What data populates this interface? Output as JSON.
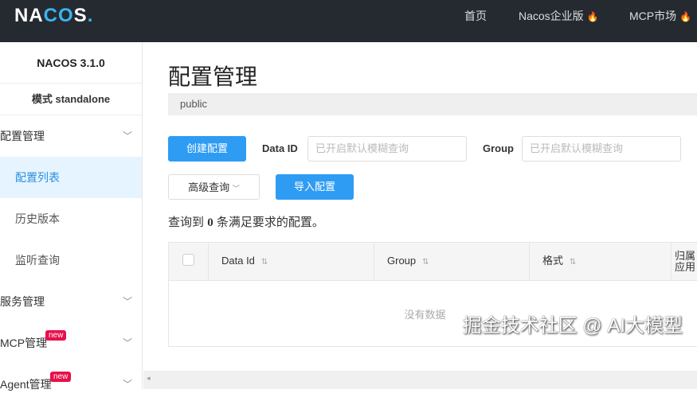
{
  "header": {
    "logo": "NACOS.",
    "nav": [
      {
        "label": "首页"
      },
      {
        "label": "Nacos企业版",
        "hot": true
      },
      {
        "label": "MCP市场",
        "hot": true
      }
    ]
  },
  "sidebar": {
    "version": "NACOS 3.1.0",
    "mode": "模式 standalone",
    "items": [
      {
        "label": "配置管理",
        "expand": true
      },
      {
        "label": "配置列表"
      },
      {
        "label": "历史版本"
      },
      {
        "label": "监听查询"
      },
      {
        "label": "服务管理"
      },
      {
        "label": "MCP管理",
        "badge": "new"
      },
      {
        "label": "Agent管理",
        "badge": "new"
      }
    ]
  },
  "main": {
    "title": "配置管理",
    "namespace": "public",
    "create_btn": "创建配置",
    "data_id_label": "Data ID",
    "data_id_placeholder": "已开启默认模糊查询",
    "group_label": "Group",
    "group_placeholder": "已开启默认模糊查询",
    "advanced_btn": "高级查询",
    "import_btn": "导入配置",
    "count_prefix": "查询到",
    "count": "0",
    "count_suffix": "条满足要求的配置。",
    "columns": [
      "Data Id",
      "Group",
      "格式",
      "归属应用"
    ],
    "empty": "没有数据"
  },
  "watermark": "掘金技术社区 @ AI大模型"
}
